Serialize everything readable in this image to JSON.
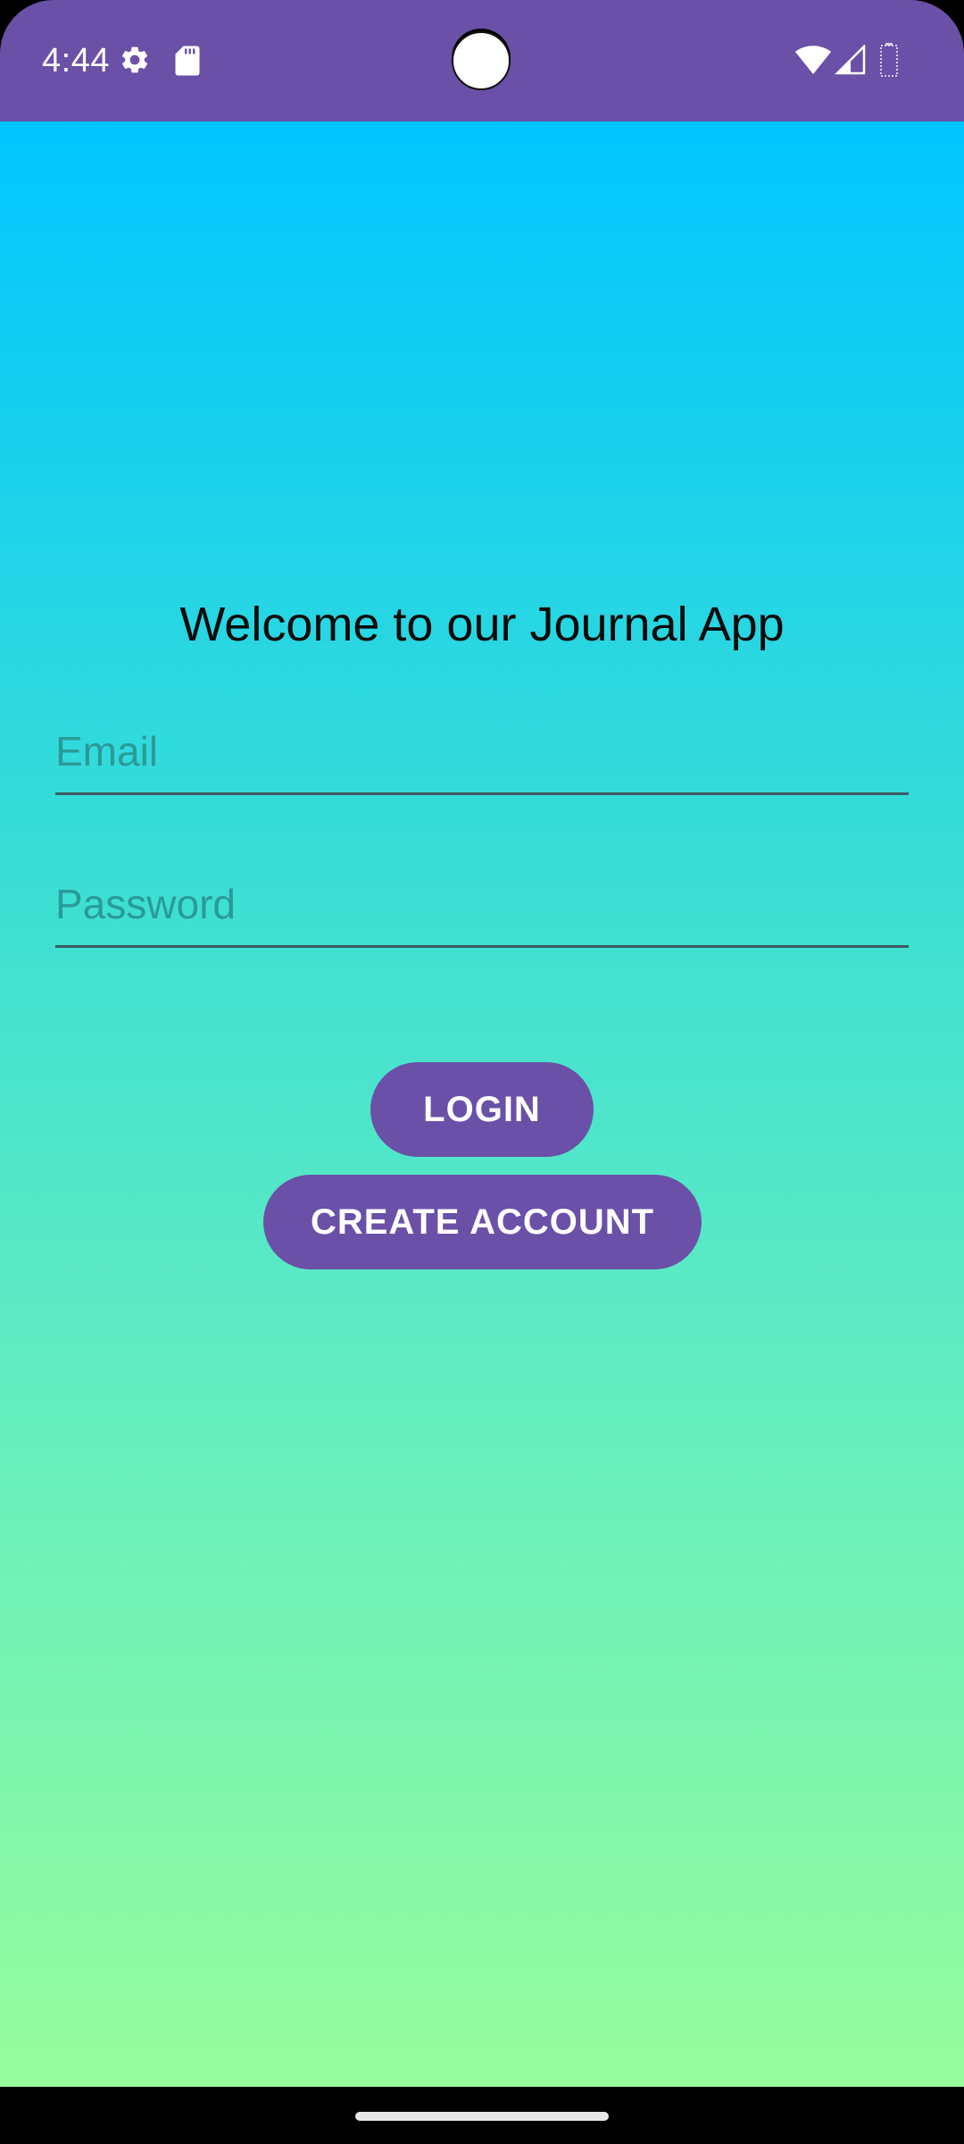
{
  "status_bar": {
    "time": "4:44",
    "background_color": "#6a50a7",
    "icons": [
      "gear-icon",
      "sdcard-icon",
      "wifi-icon",
      "signal-icon",
      "battery-icon"
    ]
  },
  "main": {
    "title": "Welcome to our Journal App",
    "email_field": {
      "placeholder": "Email",
      "value": ""
    },
    "password_field": {
      "placeholder": "Password",
      "value": ""
    },
    "login_label": "LOGIN",
    "create_account_label": "CREATE ACCOUNT",
    "gradient_top": "#00c6ff",
    "gradient_bottom": "#96fc9c",
    "button_color": "#6a50a7"
  }
}
